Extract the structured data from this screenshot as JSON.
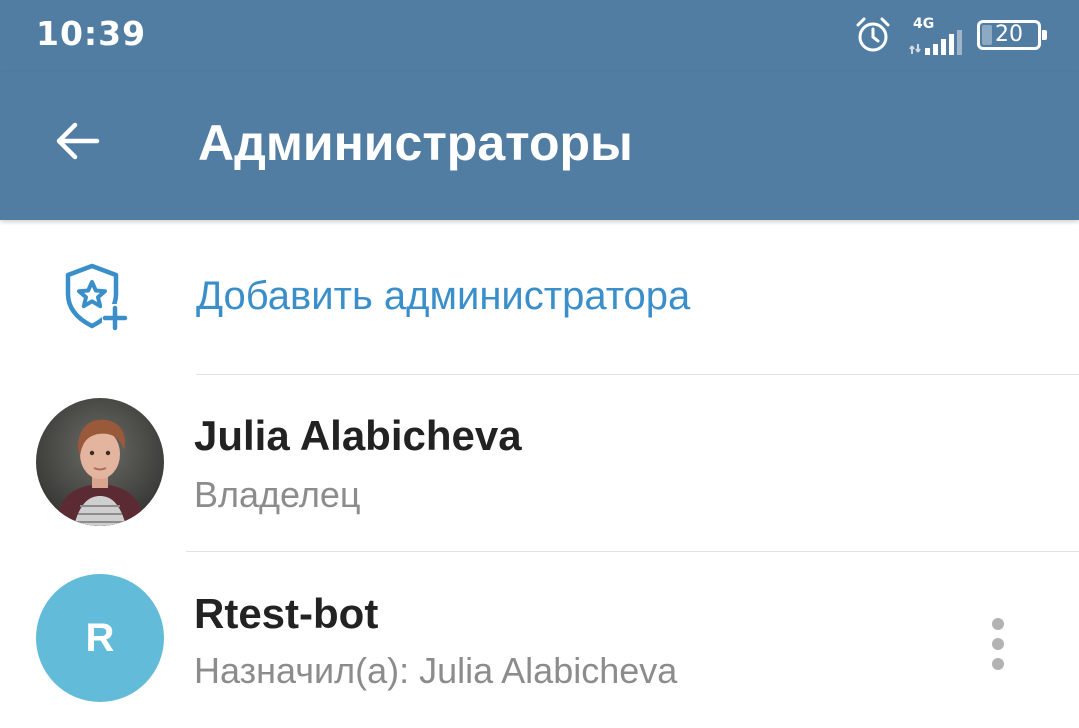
{
  "status_bar": {
    "time": "10:39",
    "network": "4G",
    "battery": "20",
    "icons": [
      "alarm-icon",
      "signal-icon",
      "battery-icon"
    ]
  },
  "app_bar": {
    "title": "Администраторы",
    "back_icon": "arrow-left-icon"
  },
  "add_admin": {
    "label": "Добавить администратора",
    "icon": "shield-star-plus-icon",
    "color": "#3a8fca"
  },
  "members": [
    {
      "name": "Julia Alabicheva",
      "status": "Владелец",
      "avatar": "photo"
    },
    {
      "name": "Rtest-bot",
      "status": "Назначил(а): Julia Alabicheva",
      "avatar_letter": "R",
      "avatar_color": "#62bcd9"
    }
  ],
  "colors": {
    "header": "#527da3",
    "accent": "#3a8fca"
  }
}
